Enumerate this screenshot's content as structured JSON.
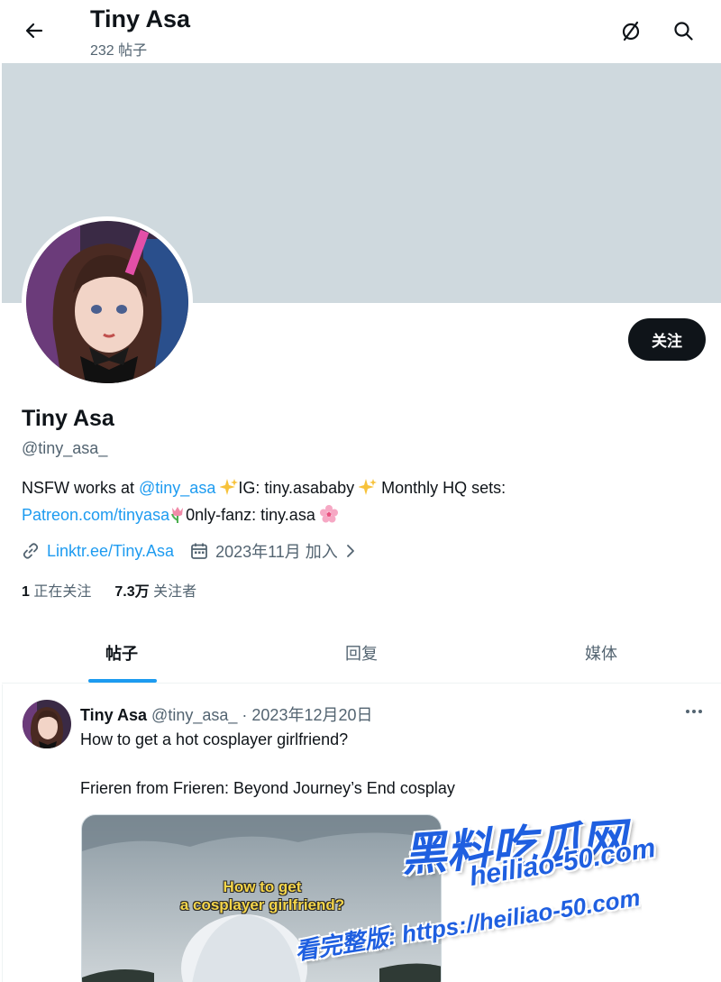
{
  "header": {
    "title": "Tiny Asa",
    "post_count": "232 帖子"
  },
  "profile": {
    "name": "Tiny Asa",
    "handle": "@tiny_asa_",
    "follow_label": "关注",
    "bio": {
      "t1": "NSFW works at ",
      "mention": "@tiny_asa",
      "t2": " ",
      "t3": "IG: tiny.asababy ",
      "t4": " Monthly HQ sets:",
      "link": "Patreon.com/tinyasa",
      "t5": "0nly-fanz: tiny.asa "
    },
    "website": "Linktr.ee/Tiny.Asa",
    "joined": "2023年11月 加入",
    "following_count": "1",
    "following_label": "正在关注",
    "followers_count": "7.3万",
    "followers_label": "关注者"
  },
  "tabs": [
    {
      "label": "帖子"
    },
    {
      "label": "回复"
    },
    {
      "label": "媒体"
    }
  ],
  "post": {
    "author_name": "Tiny Asa",
    "author_handle": "@tiny_asa_",
    "separator": "·",
    "date": "2023年12月20日",
    "line1": "How to get a hot cosplayer girlfriend?",
    "line2": "Frieren from Frieren: Beyond Journey’s End cosplay",
    "media_caption_1": "How to get",
    "media_caption_2": "a cosplayer girlfriend?"
  },
  "watermark": {
    "title": "黑料吃瓜网",
    "url": "heiliao-50.com",
    "line2": "看完整版: https://heiliao-50.com"
  },
  "colors": {
    "accent": "#1d9bf0",
    "banner": "#cfd9de",
    "text": "#0f1419",
    "muted": "#536471"
  },
  "icons": [
    "back-arrow-icon",
    "premium-slash-icon",
    "search-icon",
    "link-icon",
    "calendar-icon",
    "chevron-right-icon",
    "more-dots-icon"
  ]
}
